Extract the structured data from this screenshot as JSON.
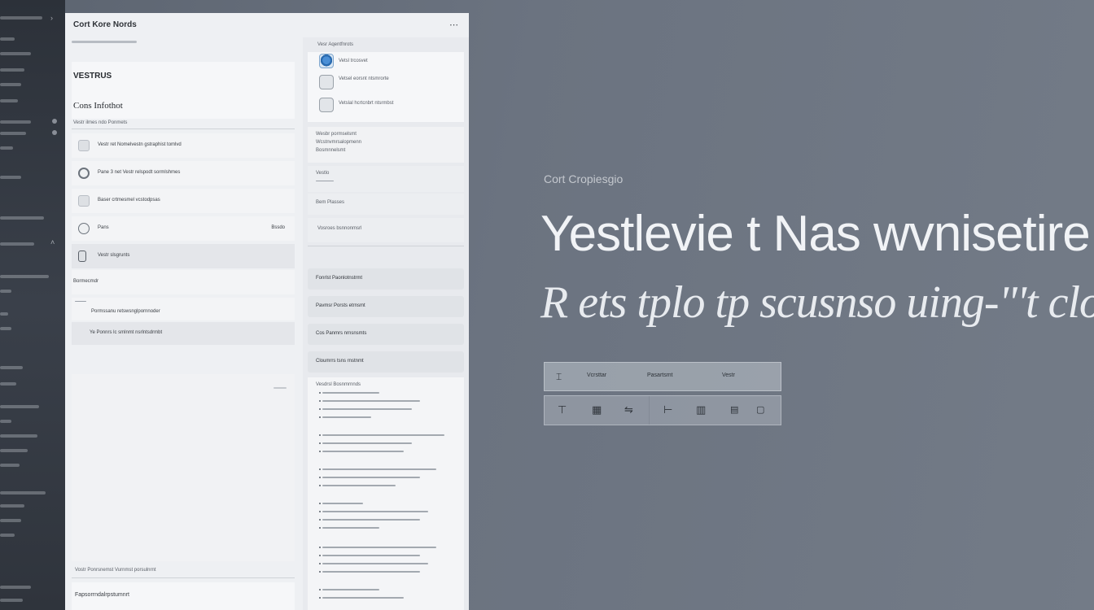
{
  "window": {
    "title": "Cort Kore Nords",
    "corner_icon": "ellipsis-icon"
  },
  "left_panel": {
    "section_title": "VESTRUS",
    "heading": "Cons Infothot",
    "subheading": "Vestr ilmes ndo Ponmets",
    "rows": [
      {
        "label": "Vestr ret Nomelvestn gstraphist tomlvd",
        "right": ""
      },
      {
        "label": "Pane 3 net  Vestr relspodt sormlshmes",
        "right": ""
      },
      {
        "label": "Baser crtmesmel vcstodpsas",
        "right": ""
      },
      {
        "label": "Pans",
        "right": "Bssdo"
      },
      {
        "label": "Vestr slsgrunts",
        "right": ""
      }
    ],
    "group_title": "Bormecmdr",
    "sub_items": [
      "Pormssanu retswsnglpornnoder",
      "Ye Ponnrs lc smlnmt nsrlntsdrmbt"
    ],
    "footer_lines": [
      "Vostr Ponrsnemst Vurnmst porsulnrnt",
      "Fapsorrndalrpstumnrt"
    ]
  },
  "right_panel": {
    "header": "Vesr Aqentfnrots",
    "items": [
      {
        "label": "Vetsl trcosvet",
        "icon": "globe-icon"
      },
      {
        "label": "Vetsel eorsnt ntsmrorte",
        "icon": "image-icon"
      },
      {
        "label": "Vetslal hcrtcnbrt ntsrmbst",
        "icon": "camera-icon"
      }
    ],
    "detail_lines": [
      "Wesbr pormselsmt",
      "Wcstnvmrsalopmenn",
      "Bosmnnelsmt"
    ],
    "field_label": "Vestlo",
    "field_value": "Bem Plasses",
    "field_note": "Vosroes bsnnonmsrl",
    "buttons": [
      "Fonrlst Paonlotnstrmt",
      "Pavmsr Porsts etrnsmt",
      "Cos Panmrs nrnsnsmts",
      "Cloumrrs tsns rnstnmt"
    ],
    "list_title": "Vesdrsl Bosnmrnnds"
  },
  "hero": {
    "kicker": "Cort Cropiesgio",
    "title": "Yestlevie t Nas wvnisetire",
    "subtitle": "R ets tplo tp scusnso uing-\"'t clo"
  },
  "toolbar": {
    "items": [
      "Vcrsttar",
      "Pasartsmt",
      "Vestr"
    ],
    "icons": [
      "text-cursor-icon",
      "table-icon",
      "merge-icon",
      "cursor-icon",
      "columns-icon",
      "window-icon"
    ]
  }
}
